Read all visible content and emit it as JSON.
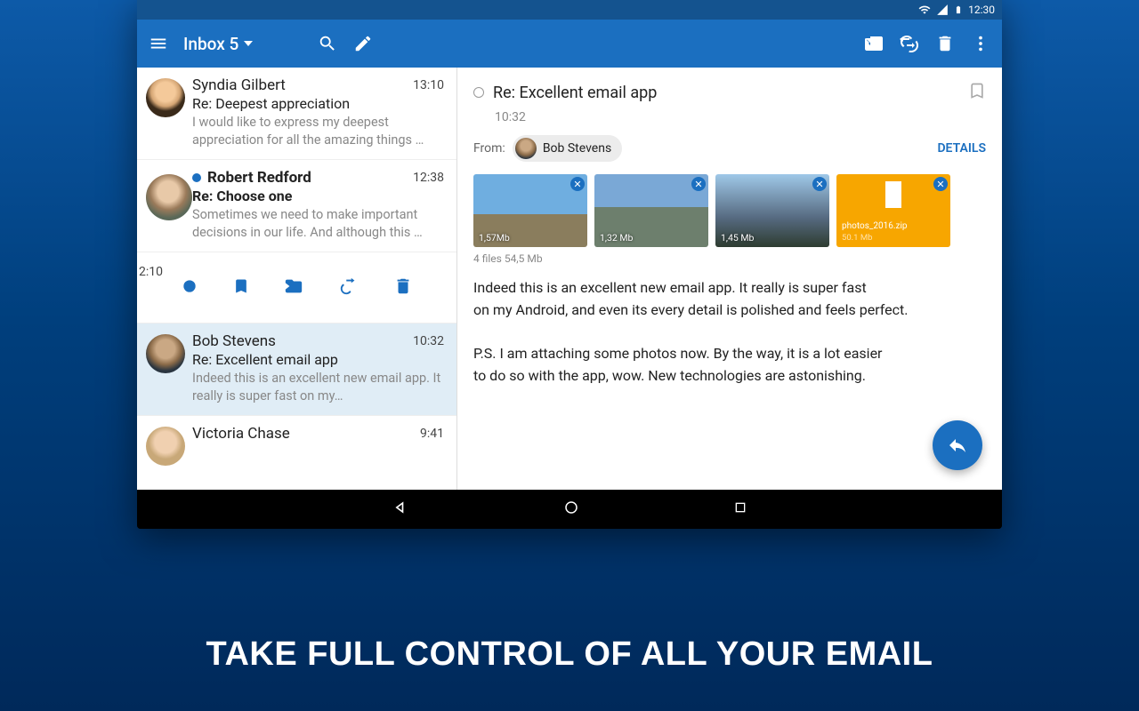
{
  "statusbar": {
    "time": "12:30"
  },
  "toolbar": {
    "title": "Inbox 5"
  },
  "emails": [
    {
      "sender": "Syndia Gilbert",
      "subject": "Re: Deepest appreciation",
      "preview": "I would like to express my deepest appreciation for all the amazing things …",
      "time": "13:10",
      "unread": false
    },
    {
      "sender": "Robert Redford",
      "subject": "Re: Choose one",
      "preview": "Sometimes we need to make important decisions in our life. And although this …",
      "time": "12:38",
      "unread": true
    },
    {
      "sender": "Bob Stevens",
      "subject": "Re: Excellent email app",
      "preview": "Indeed this is an excellent new email app. It really is super fast on my…",
      "time": "10:32",
      "unread": false
    },
    {
      "sender": "Victoria Chase",
      "subject": "",
      "preview": "",
      "time": "9:41",
      "unread": false
    }
  ],
  "peek_time": "2:10",
  "pane": {
    "subject": "Re: Excellent email app",
    "time": "10:32",
    "from_label": "From:",
    "from_name": "Bob Stevens",
    "details": "DETAILS",
    "attachments": [
      {
        "size": "1,57Mb"
      },
      {
        "size": "1,32 Mb"
      },
      {
        "size": "1,45 Mb"
      },
      {
        "name": "photos_2016.zip",
        "size": "50.1 Mb"
      }
    ],
    "att_summary": "4 files 54,5 Mb",
    "body_p1": "Indeed this is an excellent new email app. It really is super fast\non my Android, and even its every detail is polished and feels perfect.",
    "body_p2": "P.S. I am attaching some photos now. By the way, it is a lot easier\nto do so with the app, wow. New technologies are astonishing."
  },
  "caption": "TAKE FULL CONTROL OF ALL YOUR EMAIL"
}
